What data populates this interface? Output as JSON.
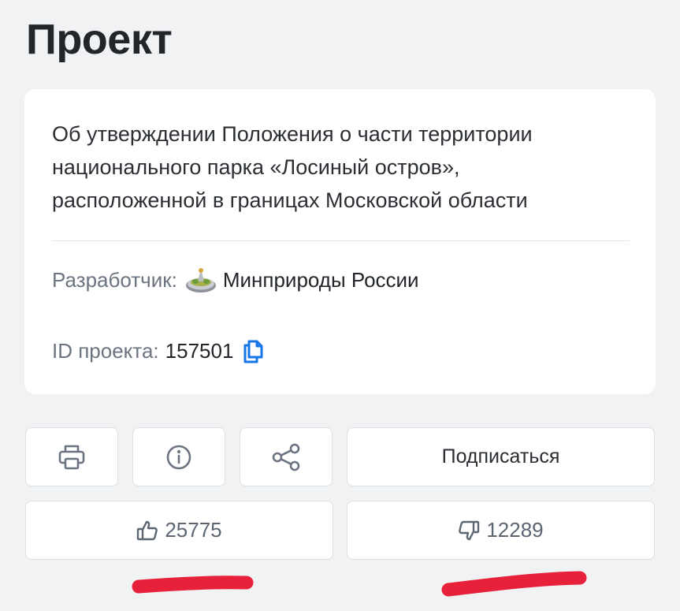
{
  "page": {
    "title": "Проект"
  },
  "project_card": {
    "description": "Об утверждении Положения о части территории национального парка «Лосиный остров», расположенной в границах Московской области",
    "developer_label": "Разработчик:",
    "developer_name": "Минприроды России",
    "developer_logo_icon": "ministry-emblem-icon",
    "id_label": "ID проекта:",
    "id_value": "157501",
    "copy_icon": "copy-icon"
  },
  "actions": {
    "print_icon": "printer-icon",
    "info_icon": "info-icon",
    "share_icon": "share-icon",
    "subscribe_label": "Подписаться"
  },
  "votes": {
    "likes": "25775",
    "dislikes": "12289",
    "like_icon": "thumbs-up-icon",
    "dislike_icon": "thumbs-down-icon"
  },
  "colors": {
    "background": "#f1f2f4",
    "card": "#ffffff",
    "accent_blue": "#1676e8",
    "annotation_red": "#e8213a",
    "icon_gray": "#6b7480"
  }
}
